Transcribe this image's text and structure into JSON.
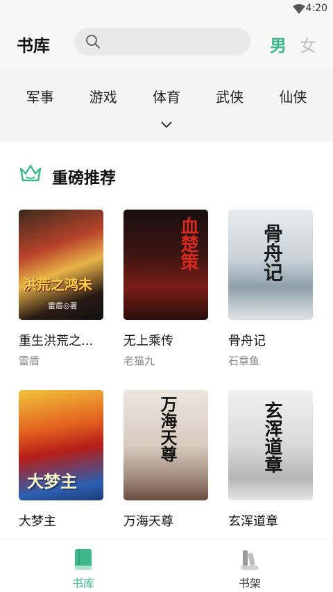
{
  "status": {
    "time": "4:20"
  },
  "header": {
    "title": "书库",
    "search_placeholder": "",
    "gender_male": "男",
    "gender_female": "女"
  },
  "categories": [
    "军事",
    "游戏",
    "体育",
    "武侠",
    "仙侠"
  ],
  "section": {
    "title": "重磅推荐"
  },
  "books": [
    {
      "title": "重生洪荒之...",
      "author": "雷盾",
      "cover_text": "洪荒之鸿未",
      "cover_sub": "雷盾◎著"
    },
    {
      "title": "无上乘传",
      "author": "老猫九",
      "cover_text": "血楚策",
      "cover_sub": ""
    },
    {
      "title": "骨舟记",
      "author": "石章鱼",
      "cover_text": "骨舟记",
      "cover_sub": ""
    },
    {
      "title": "大梦主",
      "author": "",
      "cover_text": "大梦主",
      "cover_sub": ""
    },
    {
      "title": "万海天尊",
      "author": "",
      "cover_text": "万海天尊",
      "cover_sub": ""
    },
    {
      "title": "玄浑道章",
      "author": "",
      "cover_text": "玄浑道章",
      "cover_sub": ""
    }
  ],
  "tabs": {
    "library": "书库",
    "shelf": "书架"
  },
  "colors": {
    "accent": "#3db88a",
    "tab_inactive": "#333333"
  }
}
